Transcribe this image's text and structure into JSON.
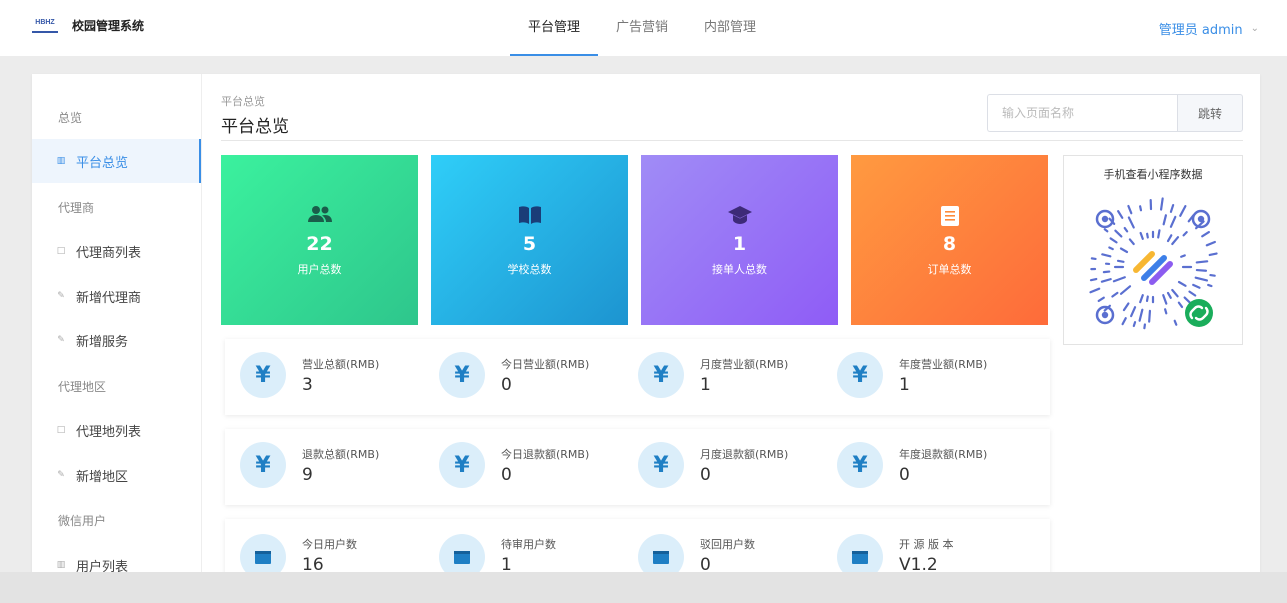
{
  "header": {
    "logo_text": "HBHZ",
    "app_name": "校园管理系统",
    "tabs": [
      {
        "label": "平台管理",
        "active": true
      },
      {
        "label": "广告营销",
        "active": false
      },
      {
        "label": "内部管理",
        "active": false
      }
    ],
    "user": "管理员 admin",
    "accent_color": "#3a8ee6"
  },
  "sidebar": {
    "groups": [
      {
        "label": "总览",
        "items": [
          {
            "label": "平台总览",
            "icon": "chart-icon",
            "active": true
          }
        ]
      },
      {
        "label": "代理商",
        "items": [
          {
            "label": "代理商列表",
            "icon": "calendar-icon"
          },
          {
            "label": "新增代理商",
            "icon": "edit-icon"
          },
          {
            "label": "新增服务",
            "icon": "edit-icon"
          }
        ]
      },
      {
        "label": "代理地区",
        "items": [
          {
            "label": "代理地列表",
            "icon": "calendar-icon"
          },
          {
            "label": "新增地区",
            "icon": "edit-icon"
          }
        ]
      },
      {
        "label": "微信用户",
        "items": [
          {
            "label": "用户列表",
            "icon": "chart-icon"
          }
        ]
      }
    ]
  },
  "page": {
    "breadcrumb": "平台总览",
    "title": "平台总览",
    "search_placeholder": "输入页面名称",
    "jump_label": "跳转"
  },
  "stats": [
    {
      "value": "22",
      "label": "用户总数",
      "icon": "users-icon",
      "colors": [
        "#3bf19e",
        "#2ec68c"
      ]
    },
    {
      "value": "5",
      "label": "学校总数",
      "icon": "book-icon",
      "colors": [
        "#2fcef8",
        "#1d94d0"
      ]
    },
    {
      "value": "1",
      "label": "接单人总数",
      "icon": "graduation-cap-icon",
      "colors": [
        "#a08cf6",
        "#8f5cf6"
      ]
    },
    {
      "value": "8",
      "label": "订单总数",
      "icon": "document-icon",
      "colors": [
        "#ff9a40",
        "#fe6b3a"
      ]
    }
  ],
  "qr": {
    "title": "手机查看小程序数据",
    "icon": "mini-program-qr-code"
  },
  "revenue": [
    {
      "label": "营业总额(RMB)",
      "value": "3",
      "icon": "yen-icon"
    },
    {
      "label": "今日营业额(RMB)",
      "value": "0",
      "icon": "yen-icon"
    },
    {
      "label": "月度营业额(RMB)",
      "value": "1",
      "icon": "yen-icon"
    },
    {
      "label": "年度营业额(RMB)",
      "value": "1",
      "icon": "yen-icon"
    }
  ],
  "refunds": [
    {
      "label": "退款总额(RMB)",
      "value": "9",
      "icon": "yen-icon"
    },
    {
      "label": "今日退款额(RMB)",
      "value": "0",
      "icon": "yen-icon"
    },
    {
      "label": "月度退款额(RMB)",
      "value": "0",
      "icon": "yen-icon"
    },
    {
      "label": "年度退款额(RMB)",
      "value": "0",
      "icon": "yen-icon"
    }
  ],
  "users_row": [
    {
      "label": "今日用户数",
      "value": "16",
      "icon": "calendar-icon"
    },
    {
      "label": "待审用户数",
      "value": "1",
      "icon": "calendar-icon"
    },
    {
      "label": "驳回用户数",
      "value": "0",
      "icon": "calendar-icon"
    },
    {
      "label": "开 源 版 本",
      "value": "V1.2",
      "icon": "calendar-icon"
    }
  ]
}
